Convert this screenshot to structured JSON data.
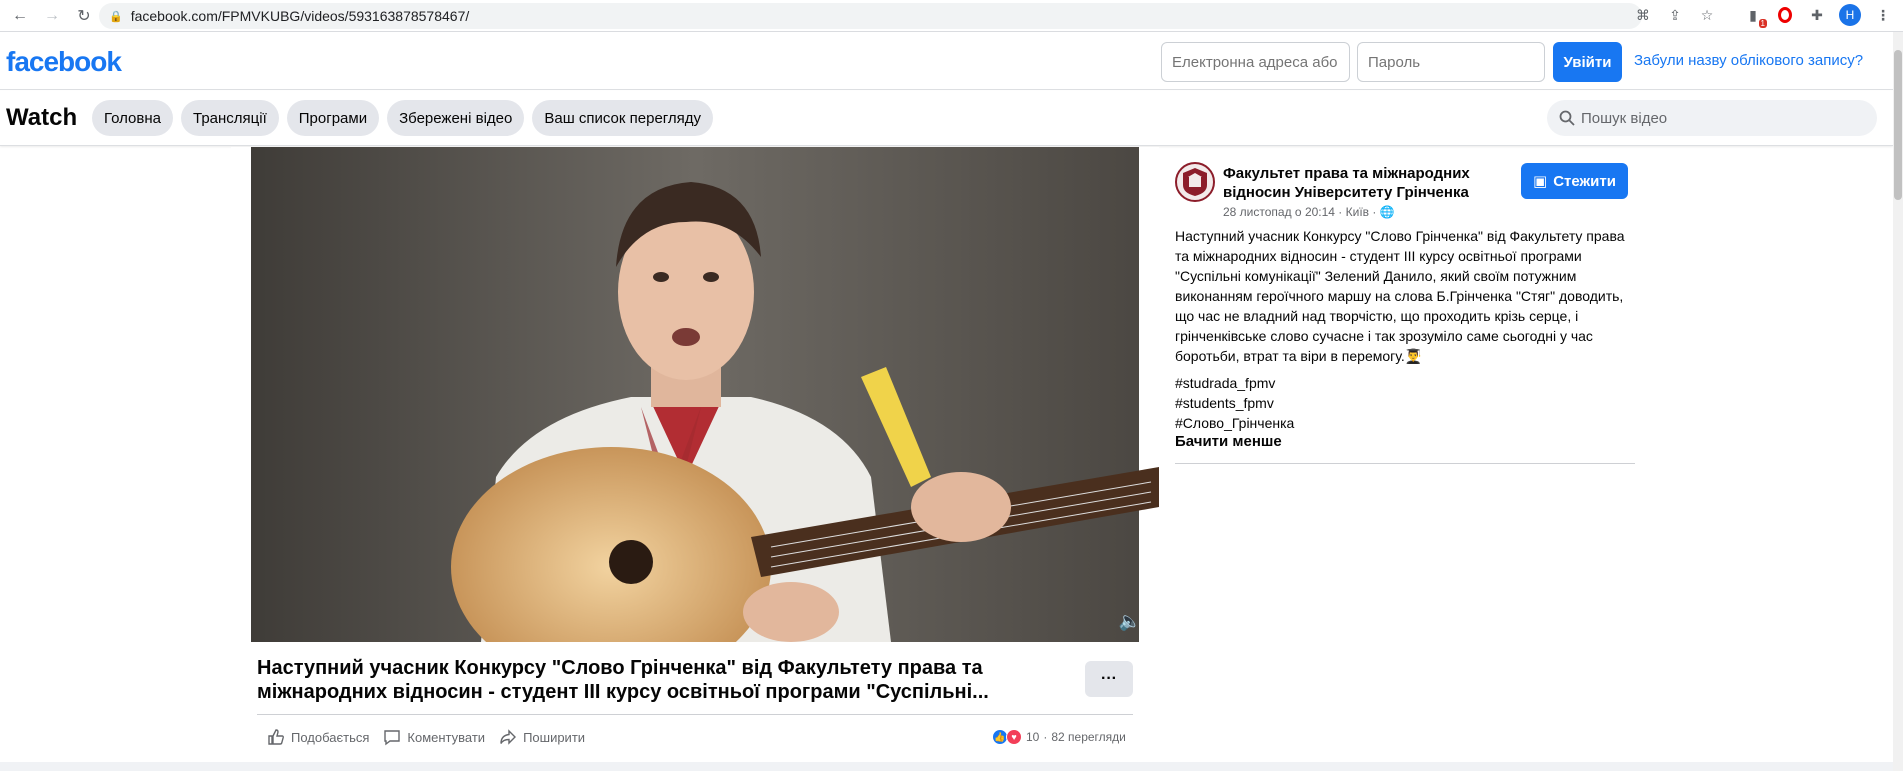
{
  "browser": {
    "url": "facebook.com/FPMVKUBG/videos/593163878578467/",
    "profile_initial": "H",
    "extension_badge": "1"
  },
  "header": {
    "logo": "facebook",
    "email_placeholder": "Електронна адреса або номер мобільного телефону",
    "password_placeholder": "Пароль",
    "login_label": "Увійти",
    "forgot_label": "Забули назву облікового запису?"
  },
  "watch": {
    "title": "Watch",
    "tabs": [
      {
        "label": "Головна"
      },
      {
        "label": "Трансляції"
      },
      {
        "label": "Програми"
      },
      {
        "label": "Збережені відео"
      },
      {
        "label": "Ваш список перегляду"
      }
    ],
    "search_placeholder": "Пошук відео"
  },
  "video": {
    "title": "Наступний учасник Конкурсу \"Слово Грінченка\" від Факультету права та міжнародних відносин - студент ІІІ курсу освітньої програми \"Суспільні...",
    "more_label": "···",
    "actions": {
      "like": "Подобається",
      "comment": "Коментувати",
      "share": "Поширити"
    },
    "reactions_count": "10",
    "views": "82 перегляди"
  },
  "post": {
    "page_name": "Факультет права та міжнародних відносин Університету Грінченка",
    "meta": "28 листопад о 20:14 · Київ ·",
    "follow_label": "Стежити",
    "text": "Наступний учасник Конкурсу \"Слово Грінченка\" від Факультету права та міжнародних відносин - студент ІІІ курсу освітньої програми \"Суспільні комунікації\" Зелений Данило, який своїм потужним виконанням героїчного маршу на слова Б.Грінченка \"Стяг\" доводить, що час не владний над творчістю, що проходить крізь серце, і грінченківське слово сучасне і так зрозуміло саме сьогодні у час боротьби, втрат та віри в перемогу.",
    "tags": [
      "#studrada_fpmv",
      "#students_fpmv",
      "#Слово_Грінченка"
    ],
    "see_less": "Бачити менше"
  },
  "colors": {
    "brand": "#1877f2",
    "pill_bg": "#e4e6eb",
    "like": "#1877f2",
    "love": "#f33e58"
  }
}
